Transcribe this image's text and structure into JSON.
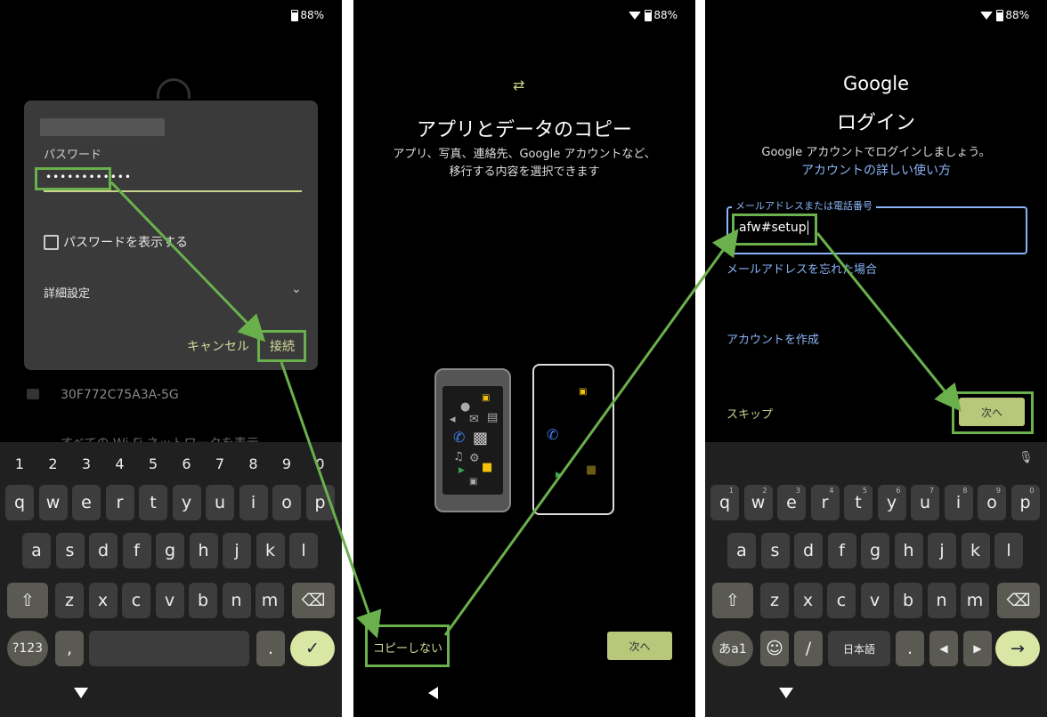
{
  "status": {
    "battery": "88%"
  },
  "screen1": {
    "dialog": {
      "password_label": "パスワード",
      "password_value": "••••••••••••",
      "show_password_label": "パスワードを表示する",
      "advanced_label": "詳細設定",
      "cancel_label": "キャンセル",
      "connect_label": "接続"
    },
    "background_network": "30F772C75A3A-5G",
    "background_all_networks": "すべての Wi-Fi ネットワークを表示",
    "keyboard": {
      "numbers": [
        "1",
        "2",
        "3",
        "4",
        "5",
        "6",
        "7",
        "8",
        "9",
        "0"
      ],
      "row1": [
        "q",
        "w",
        "e",
        "r",
        "t",
        "y",
        "u",
        "i",
        "o",
        "p"
      ],
      "row2": [
        "a",
        "s",
        "d",
        "f",
        "g",
        "h",
        "j",
        "k",
        "l"
      ],
      "row3": [
        "z",
        "x",
        "c",
        "v",
        "b",
        "n",
        "m"
      ],
      "symbols_key": "?123",
      "comma": ",",
      "period": "."
    }
  },
  "screen2": {
    "title": "アプリとデータのコピー",
    "subtitle_line1": "アプリ、写真、連絡先、Google アカウントなど、",
    "subtitle_line2": "移行する内容を選択できます",
    "no_copy_label": "コピーしない",
    "next_label": "次へ"
  },
  "screen3": {
    "logo": "Google",
    "title": "ログイン",
    "subtitle": "Google アカウントでログインしましょう。",
    "help_link": "アカウントの詳しい使い方",
    "field_label": "メールアドレスまたは電話番号",
    "field_value": "afw#setup",
    "forgot_link": "メールアドレスを忘れた場合",
    "create_link": "アカウントを作成",
    "skip_label": "スキップ",
    "next_label": "次へ",
    "keyboard": {
      "row1": [
        "q",
        "w",
        "e",
        "r",
        "t",
        "y",
        "u",
        "i",
        "o",
        "p"
      ],
      "row1_hints": [
        "1",
        "2",
        "3",
        "4",
        "5",
        "6",
        "7",
        "8",
        "9",
        "0"
      ],
      "row2": [
        "a",
        "s",
        "d",
        "f",
        "g",
        "h",
        "j",
        "k",
        "l"
      ],
      "row3": [
        "z",
        "x",
        "c",
        "v",
        "b",
        "n",
        "m"
      ],
      "mode_key": "あa1",
      "slash": "/",
      "language_key": "日本語",
      "period": "."
    }
  }
}
